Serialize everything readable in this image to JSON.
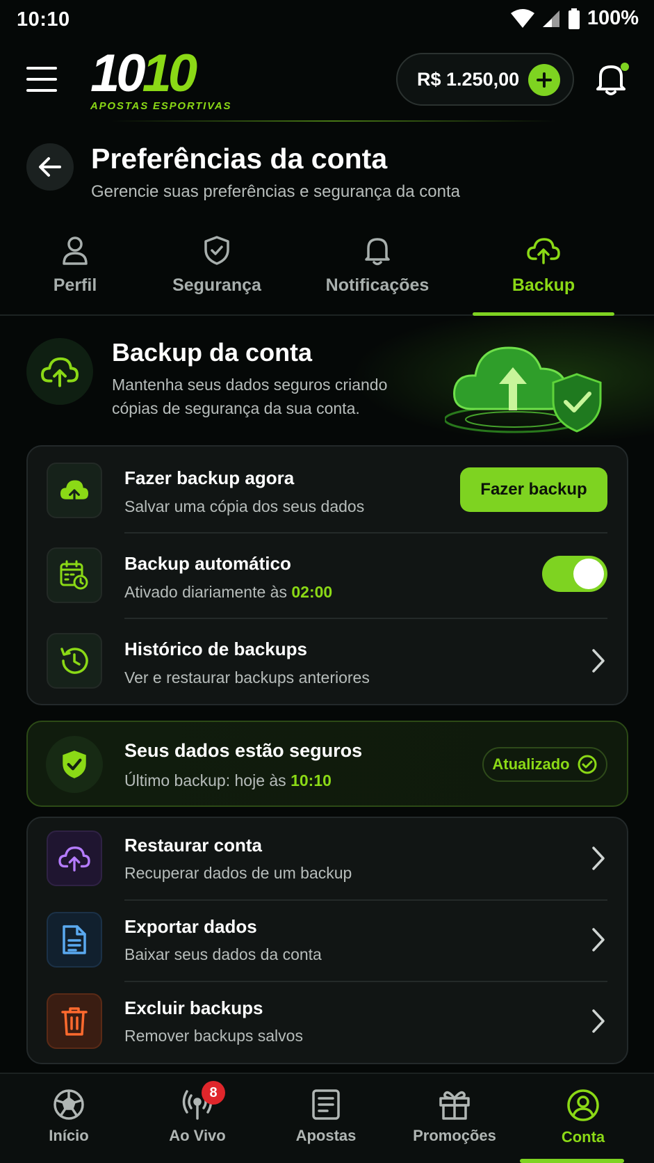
{
  "status_bar": {
    "time": "10:10",
    "battery": "100%"
  },
  "header": {
    "logo_main": "10",
    "logo_main_accent": "10",
    "logo_sub": "APOSTAS ESPORTIVAS",
    "balance": "R$ 1.250,00"
  },
  "page": {
    "title": "Preferências da conta",
    "subtitle": "Gerencie suas preferências e segurança da conta"
  },
  "tabs": [
    {
      "label": "Perfil",
      "icon": "user-icon"
    },
    {
      "label": "Segurança",
      "icon": "shield-icon"
    },
    {
      "label": "Notificações",
      "icon": "bell-icon"
    },
    {
      "label": "Backup",
      "icon": "cloud-upload-icon",
      "active": true
    }
  ],
  "hero": {
    "title": "Backup da conta",
    "description": "Mantenha seus dados seguros criando cópias de segurança da sua conta."
  },
  "backup_card": {
    "backup_now": {
      "title": "Fazer backup agora",
      "subtitle": "Salvar uma cópia dos seus dados",
      "button": "Fazer backup"
    },
    "auto_backup": {
      "title": "Backup automático",
      "subtitle_prefix": "Ativado diariamente às",
      "time": "02:00",
      "enabled": true
    },
    "history": {
      "title": "Histórico de backups",
      "subtitle": "Ver e restaurar backups anteriores"
    }
  },
  "secure_card": {
    "title": "Seus dados estão seguros",
    "subtitle_prefix": "Último backup: hoje às",
    "time": "10:10",
    "badge": "Atualizado"
  },
  "actions_card": [
    {
      "title": "Restaurar conta",
      "subtitle": "Recuperar dados de um backup",
      "icon": "cloud-upload-icon",
      "color": "#b57cff"
    },
    {
      "title": "Exportar dados",
      "subtitle": "Baixar seus dados da conta",
      "icon": "document-icon",
      "color": "#5aa9f0"
    },
    {
      "title": "Excluir backups",
      "subtitle": "Remover backups salvos",
      "icon": "trash-icon",
      "color": "#ff6a2e"
    }
  ],
  "bottom_nav": [
    {
      "label": "Início",
      "icon": "soccer-ball-icon"
    },
    {
      "label": "Ao Vivo",
      "icon": "live-broadcast-icon",
      "badge": "8"
    },
    {
      "label": "Apostas",
      "icon": "ticket-icon"
    },
    {
      "label": "Promoções",
      "icon": "gift-icon"
    },
    {
      "label": "Conta",
      "icon": "user-circle-icon",
      "active": true
    }
  ],
  "colors": {
    "accent": "#7ed321",
    "background": "#050807",
    "badge": "#e0262b"
  }
}
